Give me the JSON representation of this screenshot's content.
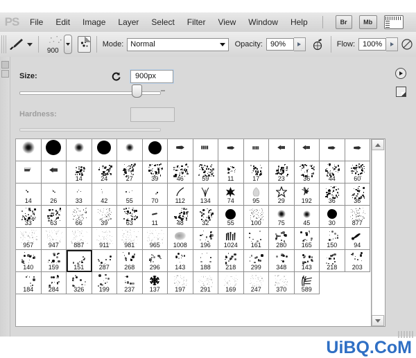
{
  "app": {
    "logo": "PS",
    "accent_blue": "#2f6fc4",
    "panel_bg": "#d9d9d9"
  },
  "menubar": {
    "items": [
      {
        "label": "File"
      },
      {
        "label": "Edit"
      },
      {
        "label": "Image"
      },
      {
        "label": "Layer"
      },
      {
        "label": "Select"
      },
      {
        "label": "Filter"
      },
      {
        "label": "View"
      },
      {
        "label": "Window"
      },
      {
        "label": "Help"
      }
    ],
    "buttons": [
      {
        "label": "Br",
        "name": "bridge-button"
      },
      {
        "label": "Mb",
        "name": "mini-bridge-button"
      },
      {
        "label": "",
        "name": "view-extras-button"
      }
    ]
  },
  "options_bar": {
    "brush_size_preview": "900",
    "mode_label": "Mode:",
    "mode_value": "Normal",
    "opacity_label": "Opacity:",
    "opacity_value": "90%",
    "flow_label": "Flow:",
    "flow_value": "100%"
  },
  "brush_panel": {
    "size_label": "Size:",
    "size_value": "900px",
    "hardness_label": "Hardness:",
    "hardness_value": "",
    "slider_percent": 90
  },
  "brush_grid": {
    "selected": "151",
    "rows": [
      [
        {
          "label": "",
          "glyph": "soft",
          "size": 18
        },
        {
          "label": "",
          "glyph": "hard",
          "size": 22
        },
        {
          "label": "",
          "glyph": "soft",
          "size": 14
        },
        {
          "label": "",
          "glyph": "hard",
          "size": 20
        },
        {
          "label": "",
          "glyph": "soft",
          "size": 12
        },
        {
          "label": "",
          "glyph": "hard",
          "size": 19
        },
        {
          "label": "",
          "glyph": "flat",
          "size": 16
        },
        {
          "label": "",
          "glyph": "bristle",
          "size": 16
        },
        {
          "label": "",
          "glyph": "flat",
          "size": 14
        },
        {
          "label": "",
          "glyph": "bristle",
          "size": 15
        },
        {
          "label": "",
          "glyph": "wedge",
          "size": 16
        },
        {
          "label": "",
          "glyph": "wedge",
          "size": 16
        },
        {
          "label": "",
          "glyph": "flat",
          "size": 15
        },
        {
          "label": "",
          "glyph": "flat",
          "size": 15
        }
      ],
      [
        {
          "label": "",
          "glyph": "chalk",
          "size": 16
        },
        {
          "label": "",
          "glyph": "wedge",
          "size": 17
        },
        {
          "label": "14",
          "glyph": "spatter",
          "size": 10
        },
        {
          "label": "24",
          "glyph": "spatter",
          "size": 14
        },
        {
          "label": "27",
          "glyph": "spatter",
          "size": 16
        },
        {
          "label": "39",
          "glyph": "spatter",
          "size": 16
        },
        {
          "label": "46",
          "glyph": "spatter",
          "size": 17
        },
        {
          "label": "59",
          "glyph": "spatter",
          "size": 17
        },
        {
          "label": "11",
          "glyph": "spatter",
          "size": 8
        },
        {
          "label": "17",
          "glyph": "spatter",
          "size": 13
        },
        {
          "label": "23",
          "glyph": "spatter",
          "size": 14
        },
        {
          "label": "36",
          "glyph": "spatter",
          "size": 16
        },
        {
          "label": "44",
          "glyph": "spatter",
          "size": 16
        },
        {
          "label": "60",
          "glyph": "spatter",
          "size": 17
        }
      ],
      [
        {
          "label": "14",
          "glyph": "tiny",
          "size": 4
        },
        {
          "label": "26",
          "glyph": "tiny",
          "size": 5
        },
        {
          "label": "33",
          "glyph": "tiny",
          "size": 6
        },
        {
          "label": "42",
          "glyph": "tiny",
          "size": 6
        },
        {
          "label": "55",
          "glyph": "tiny",
          "size": 7
        },
        {
          "label": "70",
          "glyph": "tiny",
          "size": 7
        },
        {
          "label": "112",
          "glyph": "curve",
          "size": 16
        },
        {
          "label": "134",
          "glyph": "grass",
          "size": 16
        },
        {
          "label": "74",
          "glyph": "star",
          "size": 15
        },
        {
          "label": "95",
          "glyph": "leaf",
          "size": 15
        },
        {
          "label": "29",
          "glyph": "starout",
          "size": 16
        },
        {
          "label": "192",
          "glyph": "burst",
          "size": 11
        },
        {
          "label": "36",
          "glyph": "spatter",
          "size": 15
        },
        {
          "label": "36",
          "glyph": "spatter",
          "size": 15
        }
      ],
      [
        {
          "label": "33",
          "glyph": "spatter",
          "size": 16
        },
        {
          "label": "63",
          "glyph": "spatter",
          "size": 16
        },
        {
          "label": "66",
          "glyph": "fine",
          "size": 17
        },
        {
          "label": "39",
          "glyph": "fine",
          "size": 15
        },
        {
          "label": "63",
          "glyph": "spatter",
          "size": 16
        },
        {
          "label": "11",
          "glyph": "dash",
          "size": 8
        },
        {
          "label": "48",
          "glyph": "spatter",
          "size": 16
        },
        {
          "label": "32",
          "glyph": "spatter",
          "size": 14
        },
        {
          "label": "55",
          "glyph": "hard",
          "size": 15
        },
        {
          "label": "100",
          "glyph": "fine",
          "size": 16
        },
        {
          "label": "75",
          "glyph": "soft",
          "size": 12
        },
        {
          "label": "45",
          "glyph": "soft",
          "size": 11
        },
        {
          "label": "30",
          "glyph": "blobd",
          "size": 14
        },
        {
          "label": "877",
          "glyph": "fine",
          "size": 17
        }
      ],
      [
        {
          "label": "957",
          "glyph": "faint",
          "size": 20
        },
        {
          "label": "947",
          "glyph": "faint",
          "size": 20
        },
        {
          "label": "887",
          "glyph": "faint",
          "size": 20
        },
        {
          "label": "911",
          "glyph": "faint",
          "size": 20
        },
        {
          "label": "981",
          "glyph": "faint",
          "size": 20
        },
        {
          "label": "965",
          "glyph": "faint",
          "size": 20
        },
        {
          "label": "1008",
          "glyph": "smudge",
          "size": 16
        },
        {
          "label": "196",
          "glyph": "dots",
          "size": 16
        },
        {
          "label": "1024",
          "glyph": "tools",
          "size": 16
        },
        {
          "label": "161",
          "glyph": "dots",
          "size": 16
        },
        {
          "label": "280",
          "glyph": "dots",
          "size": 14
        },
        {
          "label": "165",
          "glyph": "dots",
          "size": 15
        },
        {
          "label": "150",
          "glyph": "dots",
          "size": 15
        },
        {
          "label": "94",
          "glyph": "stroke",
          "size": 14
        }
      ],
      [
        {
          "label": "140",
          "glyph": "dots",
          "size": 17
        },
        {
          "label": "159",
          "glyph": "dots",
          "size": 16
        },
        {
          "label": "151",
          "glyph": "dots",
          "size": 17
        },
        {
          "label": "287",
          "glyph": "dots",
          "size": 17
        },
        {
          "label": "268",
          "glyph": "dots",
          "size": 16
        },
        {
          "label": "296",
          "glyph": "dots",
          "size": 16
        },
        {
          "label": "143",
          "glyph": "dots",
          "size": 14
        },
        {
          "label": "188",
          "glyph": "dots",
          "size": 15
        },
        {
          "label": "218",
          "glyph": "dots",
          "size": 16
        },
        {
          "label": "299",
          "glyph": "dots",
          "size": 16
        },
        {
          "label": "348",
          "glyph": "dots",
          "size": 16
        },
        {
          "label": "143",
          "glyph": "dots",
          "size": 15
        },
        {
          "label": "218",
          "glyph": "dots",
          "size": 16
        },
        {
          "label": "203",
          "glyph": "dots",
          "size": 16
        }
      ],
      [
        {
          "label": "184",
          "glyph": "dots",
          "size": 17
        },
        {
          "label": "284",
          "glyph": "dots",
          "size": 16
        },
        {
          "label": "326",
          "glyph": "dots",
          "size": 16
        },
        {
          "label": "199",
          "glyph": "dots",
          "size": 17
        },
        {
          "label": "237",
          "glyph": "dots",
          "size": 16
        },
        {
          "label": "137",
          "glyph": "snowflake",
          "size": 16
        },
        {
          "label": "197",
          "glyph": "faint",
          "size": 16
        },
        {
          "label": "291",
          "glyph": "faint",
          "size": 16
        },
        {
          "label": "169",
          "glyph": "faint",
          "size": 16
        },
        {
          "label": "247",
          "glyph": "faint",
          "size": 16
        },
        {
          "label": "370",
          "glyph": "faint",
          "size": 16
        },
        {
          "label": "589",
          "glyph": "grassy",
          "size": 17
        }
      ]
    ]
  },
  "watermark": {
    "text": "UiBQ.CoM"
  }
}
